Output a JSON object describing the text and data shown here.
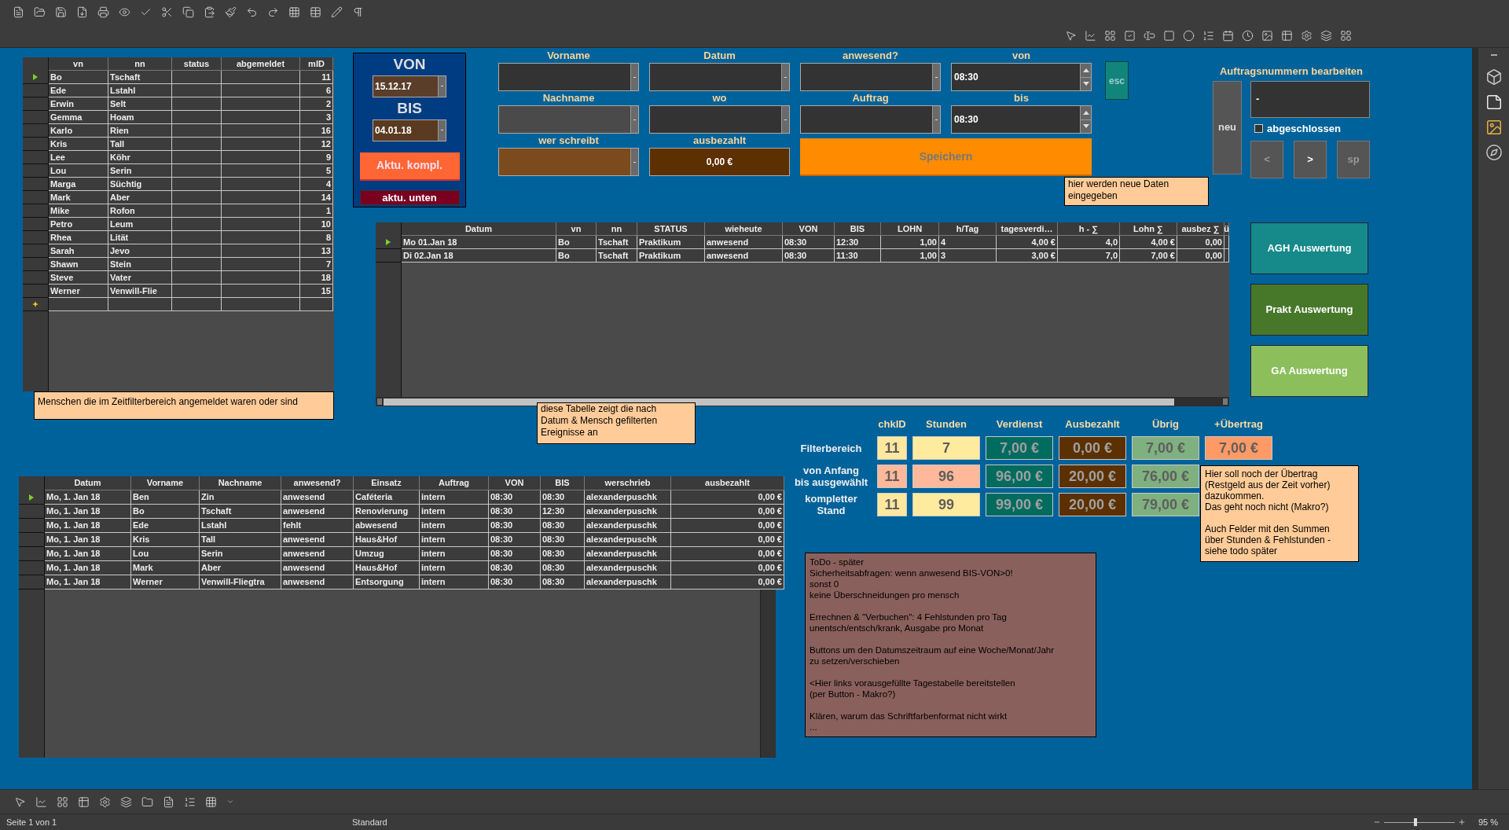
{
  "date_range": {
    "von_label": "VON",
    "von_value": "15.12.17",
    "bis_label": "BIS",
    "bis_value": "04.01.18",
    "refresh_all_button": "Aktu. kompl.",
    "refresh_lower_button": "aktu. unten"
  },
  "people_table": {
    "columns": [
      "vn",
      "nn",
      "status",
      "abgemeldet",
      "mID"
    ],
    "rows": [
      {
        "selected": true,
        "cells": [
          "Bo",
          "Tschaft",
          null,
          null,
          "11"
        ]
      },
      {
        "selected": false,
        "cells": [
          "Ede",
          "Lstahl",
          null,
          null,
          "6"
        ]
      },
      {
        "selected": false,
        "cells": [
          "Erwin",
          "Selt",
          null,
          null,
          "2"
        ]
      },
      {
        "selected": false,
        "cells": [
          "Gemma",
          "Hoam",
          null,
          null,
          "3"
        ]
      },
      {
        "selected": false,
        "cells": [
          "Karlo",
          "Rien",
          null,
          null,
          "16"
        ]
      },
      {
        "selected": false,
        "cells": [
          "Kris",
          "Tall",
          null,
          null,
          "12"
        ]
      },
      {
        "selected": false,
        "cells": [
          "Lee",
          "Köhr",
          null,
          null,
          "9"
        ]
      },
      {
        "selected": false,
        "cells": [
          "Lou",
          "Serin",
          null,
          null,
          "5"
        ]
      },
      {
        "selected": false,
        "cells": [
          "Marga",
          "Süchtig",
          null,
          null,
          "4"
        ]
      },
      {
        "selected": false,
        "cells": [
          "Mark",
          "Aber",
          null,
          null,
          "14"
        ]
      },
      {
        "selected": false,
        "cells": [
          "Mike",
          "Rofon",
          null,
          null,
          "1"
        ]
      },
      {
        "selected": false,
        "cells": [
          "Petro",
          "Leum",
          null,
          null,
          "10"
        ]
      },
      {
        "selected": false,
        "cells": [
          "Rhea",
          "Lität",
          null,
          null,
          "8"
        ]
      },
      {
        "selected": false,
        "cells": [
          "Sarah",
          "Jevo",
          null,
          null,
          "13"
        ]
      },
      {
        "selected": false,
        "cells": [
          "Shawn",
          "Stein",
          null,
          null,
          "7"
        ]
      },
      {
        "selected": false,
        "cells": [
          "Steve",
          "Vater",
          null,
          null,
          "18"
        ]
      },
      {
        "selected": false,
        "cells": [
          "Werner",
          "Venwill-Flie",
          null,
          null,
          "15"
        ]
      }
    ],
    "note": "Menschen die im Zeitfilterbereich angemeldet waren oder sind"
  },
  "entry_form": {
    "fields": [
      {
        "label": "Vorname",
        "kind": "dropdown"
      },
      {
        "label": "Datum",
        "kind": "dropdown"
      },
      {
        "label": "anwesend?",
        "kind": "dropdown"
      },
      {
        "label": "von",
        "kind": "spin",
        "value": "08:30"
      },
      {
        "label": "Nachname",
        "kind": "dropdown",
        "color": "#4a4a4a"
      },
      {
        "label": "wo",
        "kind": "dropdown"
      },
      {
        "label": "Auftrag",
        "kind": "dropdown"
      },
      {
        "label": "bis",
        "kind": "spin",
        "value": "08:30"
      },
      {
        "label": "wer schreibt",
        "kind": "dropdown",
        "color": "#7b4a1d"
      },
      {
        "label": "ausbezahlt",
        "kind": "display",
        "value": "0,00 €",
        "color": "#5c3000"
      }
    ],
    "save_button": "Speichern",
    "esc_button": "esc",
    "note": "hier werden neue Daten\neingegeben"
  },
  "order_numbers": {
    "title": "Auftragsnummern bearbeiten",
    "new_button": "neu",
    "value": "-",
    "closed_checkbox": {
      "label": "abgeschlossen",
      "checked": false
    },
    "buttons": [
      {
        "label": "<",
        "disabled": true
      },
      {
        "label": ">",
        "disabled": false
      },
      {
        "label": "sp",
        "disabled": true
      }
    ]
  },
  "events_table": {
    "columns": [
      "Datum",
      "vn",
      "nn",
      "STATUS",
      "wieheute",
      "VON",
      "BIS",
      "LOHN",
      "h/Tag",
      "tagesverdi…",
      "h - ∑",
      "Lohn ∑",
      "ausbez ∑",
      "ü"
    ],
    "rows": [
      {
        "selected": true,
        "cells": [
          "Mo 01.Jan 18",
          "Bo",
          "Tschaft",
          "Praktikum",
          "anwesend",
          "08:30",
          "12:30",
          "1,00",
          "4",
          "4,00 €",
          "4,0",
          "4,00 €",
          "0,00",
          null
        ]
      },
      {
        "selected": false,
        "cells": [
          "Di 02.Jan 18",
          "Bo",
          "Tschaft",
          "Praktikum",
          "anwesend",
          "08:30",
          "11:30",
          "1,00",
          "3",
          "3,00 €",
          "7,0",
          "7,00 €",
          "0,00",
          null
        ]
      }
    ],
    "note": "diese Tabelle zeigt die nach\nDatum & Mensch  gefilterten\nEreignisse  an"
  },
  "report_buttons": [
    {
      "label": "AGH Auswertung",
      "color": "#16898a"
    },
    {
      "label": "Prakt Auswertung",
      "color": "#47782a"
    },
    {
      "label": "GA Auswertung",
      "color": "#8cbf5c"
    }
  ],
  "summary": {
    "columns": [
      "chkID",
      "Stunden",
      "Verdienst",
      "Ausbezahlt",
      "Übrig",
      "+Übertrag"
    ],
    "rows": [
      {
        "label": "Filterbereich",
        "cells": [
          {
            "value": "11",
            "color": "#ffe89e"
          },
          {
            "value": "7",
            "color": "#ffeb9e"
          },
          {
            "value": "7,00 €",
            "color": "#006b5f"
          },
          {
            "value": "0,00 €",
            "color": "#5c3000"
          },
          {
            "value": "7,00 €",
            "color": "#7fb07f"
          },
          {
            "value": "7,00 €",
            "color": "#ff9a66"
          }
        ]
      },
      {
        "label": "von Anfang\nbis ausgewählt",
        "cells": [
          {
            "value": "11",
            "color": "#ffb899"
          },
          {
            "value": "96",
            "color": "#ffb899"
          },
          {
            "value": "96,00 €",
            "color": "#006b5f"
          },
          {
            "value": "20,00 €",
            "color": "#5c3000"
          },
          {
            "value": "76,00 €",
            "color": "#7fb07f"
          }
        ]
      },
      {
        "label": "kompletter\nStand",
        "cells": [
          {
            "value": "11",
            "color": "#ffe89e"
          },
          {
            "value": "99",
            "color": "#ffeb9e"
          },
          {
            "value": "99,00 €",
            "color": "#006b5f"
          },
          {
            "value": "20,00 €",
            "color": "#5c3000"
          },
          {
            "value": "79,00 €",
            "color": "#7fb07f"
          }
        ]
      }
    ],
    "note": "Hier soll noch der Übertrag\n(Restgeld aus der Zeit vorher)\ndazukommen.\nDas geht noch nicht (Makro?)\n\nAuch  Felder mit den Summen\nüber Stunden & Fehlstunden -\nsiehe todo später"
  },
  "todo_note": "ToDo - später\nSicherheitsabfragen: wenn anwesend BIS-VON>0!\nsonst 0\nkeine Überschneidungen pro mensch\n\nErrechnen & \"Verbuchen\": 4 Fehlstunden pro Tag\nunentsch/entsch/krank, Ausgabe pro Monat\n\nButtons um den Datumszeitraum auf eine Woche/Monat/Jahr\nzu setzen/verschieben\n\n<Hier links vorausgefüllte Tagestabelle bereitstellen\n(per Button - Makro?)\n\nKlären, warum das Schriftfarbenformat nicht wirkt\n...",
  "day_table": {
    "columns": [
      "Datum",
      "Vorname",
      "Nachname",
      "anwesend?",
      "Einsatz",
      "Auftrag",
      "VON",
      "BIS",
      "werschrieb",
      "ausbezahlt"
    ],
    "rows": [
      {
        "selected": true,
        "cells": [
          "Mo, 1. Jan 18",
          "Ben",
          "Zin",
          "anwesend",
          "Caféteria",
          "intern",
          "08:30",
          "08:30",
          "alexanderpuschk",
          "0,00 €"
        ]
      },
      {
        "selected": false,
        "cells": [
          "Mo, 1. Jan 18",
          "Bo",
          "Tschaft",
          "anwesend",
          "Renovierung",
          "intern",
          "08:30",
          "12:30",
          "alexanderpuschk",
          "0,00 €"
        ]
      },
      {
        "selected": false,
        "cells": [
          "Mo, 1. Jan 18",
          "Ede",
          "Lstahl",
          "fehlt",
          "abwesend",
          "intern",
          "08:30",
          "08:30",
          "alexanderpuschk",
          "0,00 €"
        ]
      },
      {
        "selected": false,
        "cells": [
          "Mo, 1. Jan 18",
          "Kris",
          "Tall",
          "anwesend",
          "Haus&Hof",
          "intern",
          "08:30",
          "08:30",
          "alexanderpuschk",
          "0,00 €"
        ]
      },
      {
        "selected": false,
        "cells": [
          "Mo, 1. Jan 18",
          "Lou",
          "Serin",
          "anwesend",
          "Umzug",
          "intern",
          "08:30",
          "08:30",
          "alexanderpuschk",
          "0,00 €"
        ]
      },
      {
        "selected": false,
        "cells": [
          "Mo, 1. Jan 18",
          "Mark",
          "Aber",
          "anwesend",
          "Haus&Hof",
          "intern",
          "08:30",
          "08:30",
          "alexanderpuschk",
          "0,00 €"
        ]
      },
      {
        "selected": false,
        "cells": [
          "Mo, 1. Jan 18",
          "Werner",
          "Venwill-Fliegtra",
          "anwesend",
          "Entsorgung",
          "intern",
          "08:30",
          "08:30",
          "alexanderpuschk",
          "0,00 €"
        ]
      }
    ]
  },
  "status_bar": {
    "page": "Seite 1 von 1",
    "style": "Standard",
    "zoom": "95 %",
    "zoom_slider": {
      "level": 0.45
    }
  }
}
